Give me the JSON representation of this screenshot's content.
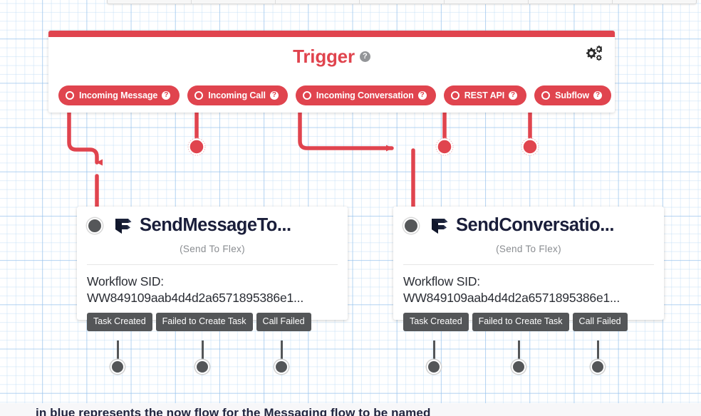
{
  "canvas": {
    "grid": true,
    "background_color": "#ffffff",
    "grid_color": "#91beeb"
  },
  "top_toolbar": {
    "name": "toolbar-sliver",
    "segments": 7
  },
  "trigger_panel": {
    "title": "Trigger",
    "title_color": "#E0444E",
    "help_glyph": "?",
    "gear_icon": "gear-icon",
    "accent_color": "#E0444E",
    "pills": [
      {
        "label": "Incoming Message",
        "help": "?"
      },
      {
        "label": "Incoming Call",
        "help": "?"
      },
      {
        "label": "Incoming Conversation",
        "help": "?"
      },
      {
        "label": "REST API",
        "help": "?"
      },
      {
        "label": "Subflow",
        "help": "?"
      }
    ]
  },
  "widgets": [
    {
      "name": "SendMessageTo...",
      "subtitle": "(Send To Flex)",
      "body_label": "Workflow SID:",
      "body_value": "WW849109aab4d4d2a6571895386e1...",
      "logo": "flex-logo-icon",
      "outputs": [
        "Task Created",
        "Failed to Create Task",
        "Call Failed"
      ]
    },
    {
      "name": "SendConversatio...",
      "subtitle": "(Send To Flex)",
      "body_label": "Workflow SID:",
      "body_value": "WW849109aab4d4d2a6571895386e1...",
      "logo": "flex-logo-icon",
      "outputs": [
        "Task Created",
        "Failed to Create Task",
        "Call Failed"
      ]
    }
  ],
  "bottom_caption": {
    "text": "in blue represents the now flow for the Messaging flow to be named"
  },
  "colors": {
    "accent_red": "#E0444E",
    "widget_dark": "#545658",
    "widget_title": "#1A1E3A",
    "muted_text": "#8a8d91"
  }
}
